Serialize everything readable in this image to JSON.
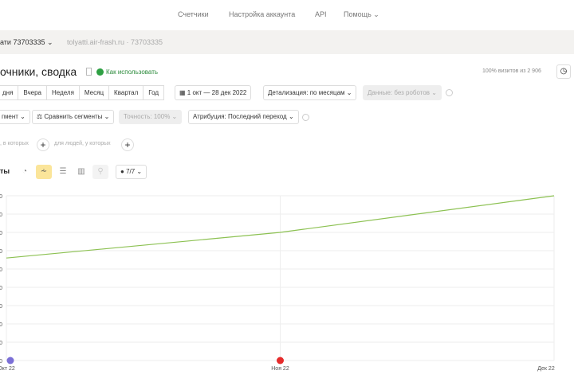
{
  "topnav": {
    "counters": "Счетчики",
    "account_settings": "Настройка аккаунта",
    "api": "API",
    "help": "Помощь"
  },
  "counter": {
    "name": "ати 73703335",
    "site": "tolyatti.air-frash.ru · 73703335"
  },
  "page": {
    "title": "очники, сводка",
    "how_to": "Как использовать",
    "visits_info": "100% визитов из 2 906"
  },
  "periods": [
    "дня",
    "Вчера",
    "Неделя",
    "Месяц",
    "Квартал",
    "Год"
  ],
  "date_range": "1 окт — 28 дек 2022",
  "detail": "Детализация: по месяцам",
  "data_filter": "Данные: без роботов",
  "segment": "гмент",
  "compare": "Сравнить сегменты",
  "accuracy": "Точность: 100%",
  "attribution": "Атрибуция: Последний переход",
  "filters": {
    "visits_where": ", в которых",
    "people_where": "для людей, у которых"
  },
  "chart_section": {
    "title": "ты",
    "metrics_count": "7/7"
  },
  "chart_data": {
    "type": "line",
    "categories": [
      "Окт 22",
      "Ноя 22",
      "Дек 22"
    ],
    "values": [
      5.6,
      7.0,
      9.0
    ],
    "ylim": [
      0,
      9
    ],
    "ytick_labels": [
      "0",
      "0",
      "0",
      "0",
      "0",
      "0",
      "0",
      "0",
      "0",
      "0"
    ],
    "line_color": "#8cc152",
    "markers": [
      {
        "category": "Окт 22",
        "color": "#7b6fd6"
      },
      {
        "category": "Ноя 22",
        "color": "#e52b2b"
      }
    ]
  }
}
